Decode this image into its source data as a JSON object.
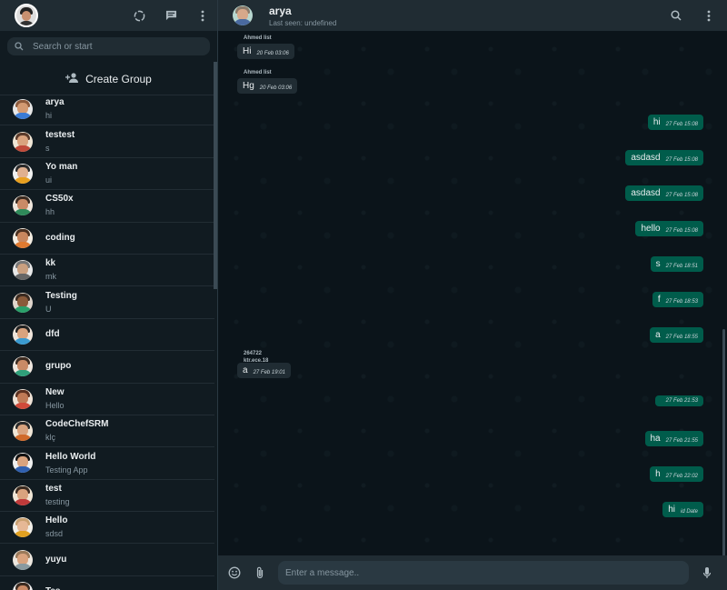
{
  "sidebar": {
    "search_placeholder": "Search or start",
    "create_group_label": "Create Group",
    "chats": [
      {
        "name": "arya",
        "last": "hi"
      },
      {
        "name": "testest",
        "last": "s"
      },
      {
        "name": "Yo man",
        "last": "ui"
      },
      {
        "name": "CS50x",
        "last": "hh"
      },
      {
        "name": "coding",
        "last": ""
      },
      {
        "name": "kk",
        "last": "mk"
      },
      {
        "name": "Testing",
        "last": "U"
      },
      {
        "name": "dfd",
        "last": ""
      },
      {
        "name": "grupo",
        "last": ""
      },
      {
        "name": "New",
        "last": "Hello"
      },
      {
        "name": "CodeChefSRM",
        "last": "klç"
      },
      {
        "name": "Hello World",
        "last": "Testing App"
      },
      {
        "name": "test",
        "last": "testing"
      },
      {
        "name": "Hello",
        "last": "sdsd"
      },
      {
        "name": "yuyu",
        "last": ""
      },
      {
        "name": "Tes",
        "last": ""
      }
    ]
  },
  "chat": {
    "name": "arya",
    "status": "Last seen: undefined",
    "composer_placeholder": "Enter a message.."
  },
  "messages": [
    {
      "dir": "in",
      "sender": "Ahmed list",
      "text": "Hi",
      "time": "20 Feb 03:06"
    },
    {
      "dir": "in",
      "sender": "Ahmed list",
      "text": "Hg",
      "time": "20 Feb 03:06"
    },
    {
      "dir": "out",
      "text": "hi",
      "time": "27 Feb 15:08"
    },
    {
      "dir": "out",
      "text": "asdasd",
      "time": "27 Feb 15:08"
    },
    {
      "dir": "out",
      "text": "asdasd",
      "time": "27 Feb 15:08"
    },
    {
      "dir": "out",
      "text": "hello",
      "time": "27 Feb 15:08"
    },
    {
      "dir": "out",
      "text": "s",
      "time": "27 Feb 18:51"
    },
    {
      "dir": "out",
      "text": "f",
      "time": "27 Feb 18:53"
    },
    {
      "dir": "out",
      "text": "a",
      "time": "27 Feb 18:55"
    },
    {
      "dir": "in",
      "sender": "264722",
      "sender2": "ktr.ece.18",
      "text": "a",
      "time": "27 Feb 19:01"
    },
    {
      "dir": "out",
      "text": "",
      "time": "27 Feb 21:53"
    },
    {
      "dir": "out",
      "text": "ha",
      "time": "27 Feb 21:55"
    },
    {
      "dir": "out",
      "text": "h",
      "time": "27 Feb 22:02"
    },
    {
      "dir": "out",
      "text": "hi",
      "time": "id Date"
    }
  ],
  "colors": {
    "panel": "#202c33",
    "background": "#0b141a",
    "outgoing": "#005c4b",
    "incoming": "#202c33"
  },
  "icons": [
    "status-icon",
    "new-chat-icon",
    "menu-dots-icon",
    "search-icon",
    "add-group-icon",
    "emoji-icon",
    "attach-icon",
    "mic-icon"
  ]
}
